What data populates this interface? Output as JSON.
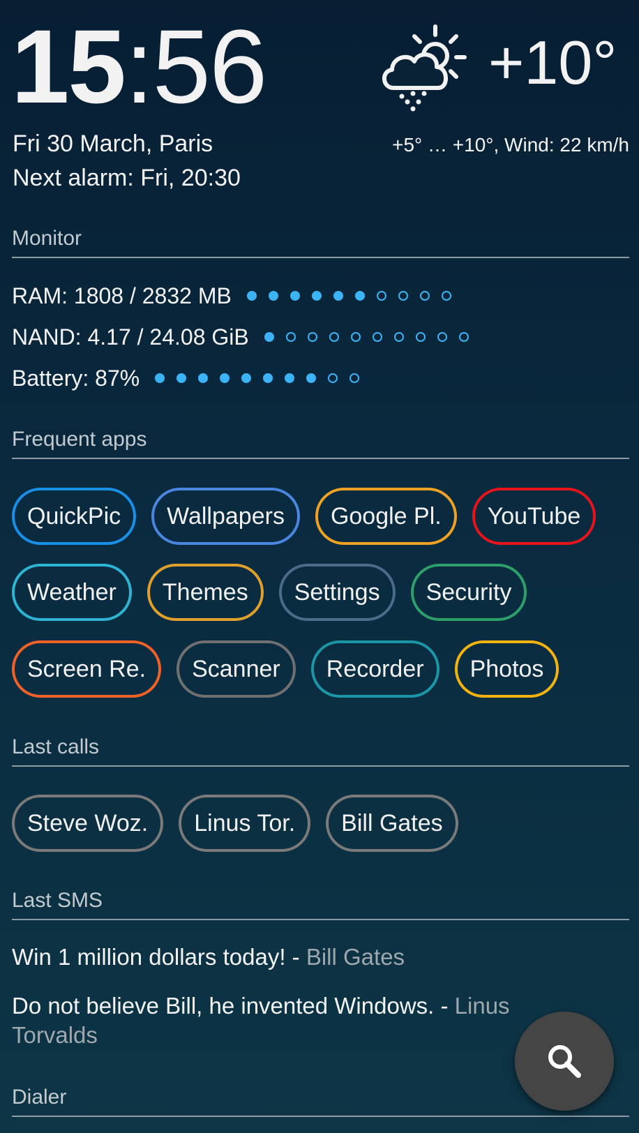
{
  "clock": {
    "hours": "15",
    "separator": ":",
    "minutes": "56"
  },
  "date_text": "Fri 30 March, Paris",
  "alarm_text": "Next alarm: Fri, 20:30",
  "weather": {
    "icon": "partly-cloudy-rain-icon",
    "temperature": "+10°",
    "detail": "+5° … +10°, Wind: 22 km/h"
  },
  "sections": {
    "monitor": "Monitor",
    "frequent_apps": "Frequent apps",
    "last_calls": "Last calls",
    "last_sms": "Last SMS",
    "dialer": "Dialer"
  },
  "monitor": [
    {
      "label": "RAM: 1808 / 2832 MB",
      "level": 6,
      "of": 10
    },
    {
      "label": "NAND: 4.17 / 24.08 GiB",
      "level": 1,
      "of": 10
    },
    {
      "label": "Battery: 87%",
      "level": 8,
      "of": 10
    }
  ],
  "monitor_dot_color": "#3bb3f5",
  "frequent_apps": [
    [
      {
        "label": "QuickPic",
        "color": "#1a8fe6"
      },
      {
        "label": "Wallpapers",
        "color": "#4a86e0"
      },
      {
        "label": "Google Pl.",
        "color": "#eea223"
      },
      {
        "label": "YouTube",
        "color": "#e8141c"
      }
    ],
    [
      {
        "label": "Weather",
        "color": "#2fb3d3"
      },
      {
        "label": "Themes",
        "color": "#e0a02c"
      },
      {
        "label": "Settings",
        "color": "#4c6a8a"
      },
      {
        "label": "Security",
        "color": "#2c9f6a"
      }
    ],
    [
      {
        "label": "Screen Re.",
        "color": "#ee6127"
      },
      {
        "label": "Scanner",
        "color": "#707070"
      },
      {
        "label": "Recorder",
        "color": "#1b96a6"
      },
      {
        "label": "Photos",
        "color": "#f2b20f"
      }
    ]
  ],
  "last_calls": [
    {
      "label": "Steve Woz.",
      "color": "#7a7a7a"
    },
    {
      "label": "Linus Tor.",
      "color": "#7a7a7a"
    },
    {
      "label": "Bill Gates",
      "color": "#7a7a7a"
    }
  ],
  "last_sms": [
    {
      "message": "Win 1 million dollars today! - ",
      "sender": "Bill Gates"
    },
    {
      "message": "Do not believe Bill, he invented Windows. - ",
      "sender": "Linus Torvalds"
    }
  ],
  "fab": {
    "icon": "search-icon"
  }
}
